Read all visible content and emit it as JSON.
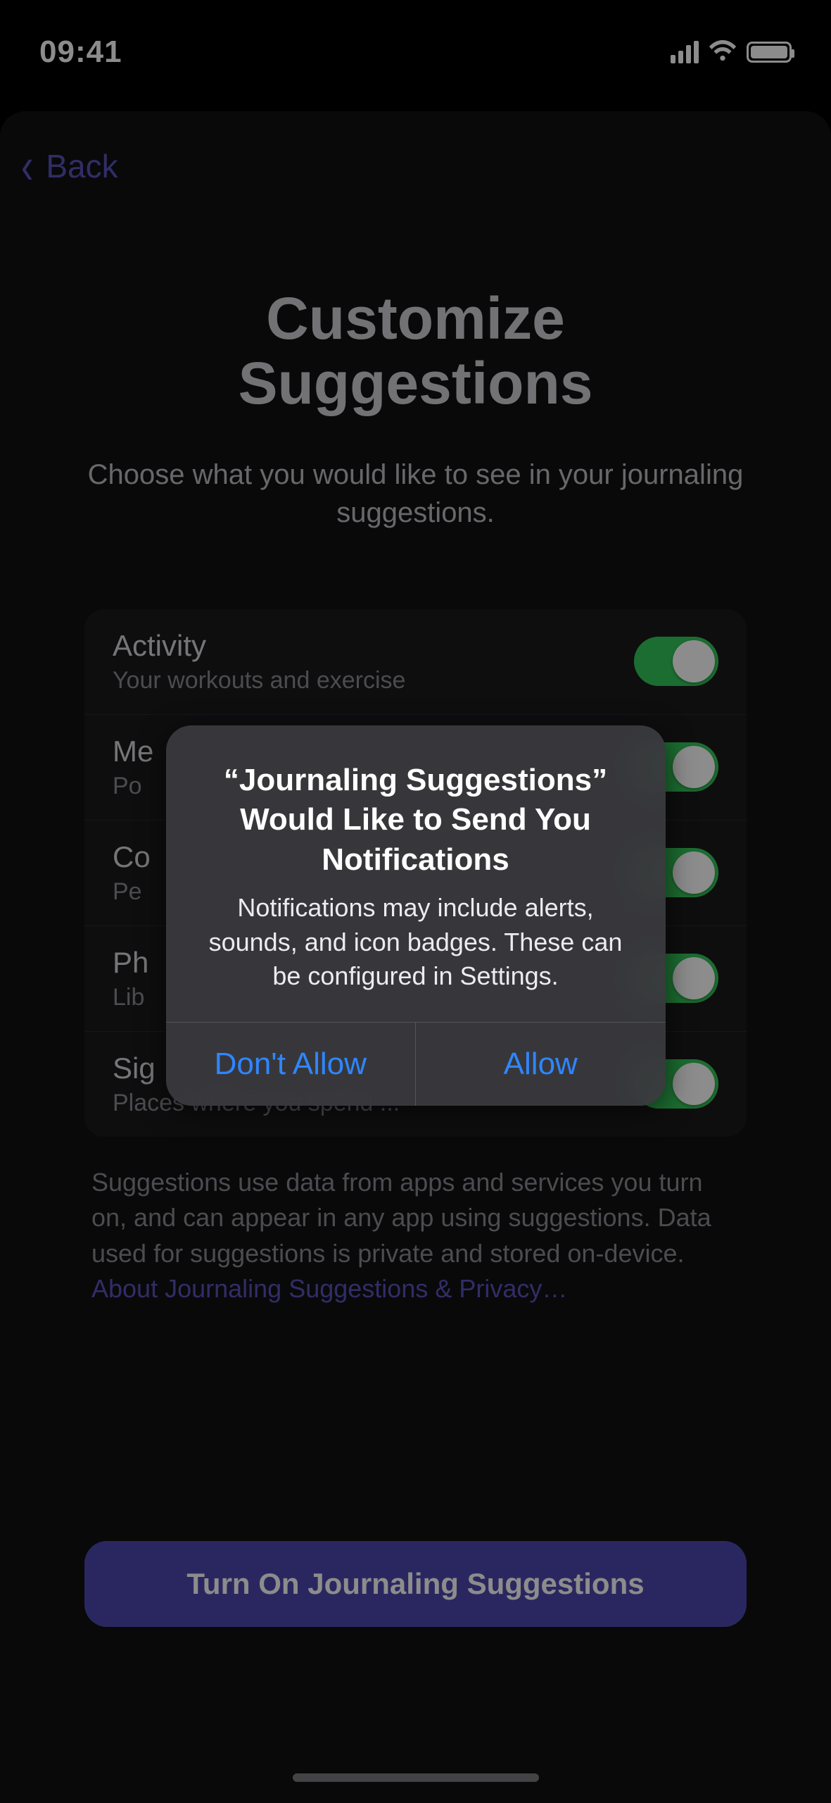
{
  "status": {
    "time": "09:41"
  },
  "nav": {
    "back_label": "Back"
  },
  "page": {
    "title_line1": "Customize",
    "title_line2": "Suggestions",
    "subtitle": "Choose what you would like to see in your journaling suggestions."
  },
  "list": {
    "items": [
      {
        "title": "Activity",
        "subtitle": "Your workouts and exercise",
        "on": true
      },
      {
        "title": "Me",
        "subtitle": "Po",
        "on": true
      },
      {
        "title": "Co",
        "subtitle": "Pe",
        "on": true
      },
      {
        "title": "Ph",
        "subtitle": "Lib",
        "on": true
      },
      {
        "title": "Sig",
        "subtitle": "Places where you spend ...",
        "on": true
      }
    ]
  },
  "footnote": {
    "text": "Suggestions use data from apps and services you turn on, and can appear in any app using suggestions. Data used for suggestions is private and stored on-device. ",
    "link": "About Journaling Suggestions & Privacy…"
  },
  "primary_button": "Turn On Journaling Suggestions",
  "alert": {
    "title": "“Journaling Suggestions” Would Like to Send You Notifications",
    "message": "Notifications may include alerts, sounds, and icon badges. These can be configured in Settings.",
    "dont_allow": "Don't Allow",
    "allow": "Allow"
  }
}
